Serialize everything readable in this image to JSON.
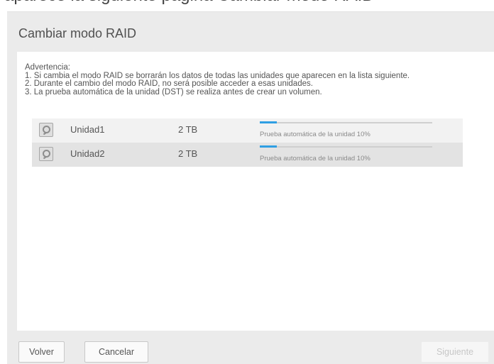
{
  "background_text": "aparece la siguiente página Cambiar modo RAID",
  "dialog": {
    "title": "Cambiar modo RAID"
  },
  "warning": {
    "heading": "Advertencia:",
    "line1": "1. Si cambia el modo RAID se borrarán los datos de todas las unidades que aparecen en la lista siguiente.",
    "line2": "2. Durante el cambio del modo RAID, no será posible acceder a esas unidades.",
    "line3": "3. La prueba automática de la unidad (DST) se realiza antes de crear un volumen."
  },
  "drives": [
    {
      "name": "Unidad1",
      "size": "2 TB",
      "status": "Prueba automática de la unidad 10%",
      "progress_pct": 10,
      "icon": "hard-drive-icon"
    },
    {
      "name": "Unidad2",
      "size": "2 TB",
      "status": "Prueba automática de la unidad 10%",
      "progress_pct": 10,
      "icon": "hard-drive-icon"
    }
  ],
  "buttons": {
    "back": "Volver",
    "cancel": "Cancelar",
    "next": "Siguiente"
  },
  "colors": {
    "progress": "#2f9fe3",
    "panel": "#ebebeb",
    "row_alt": "#e3e3e3",
    "disabled_text": "#c7c7c7"
  }
}
